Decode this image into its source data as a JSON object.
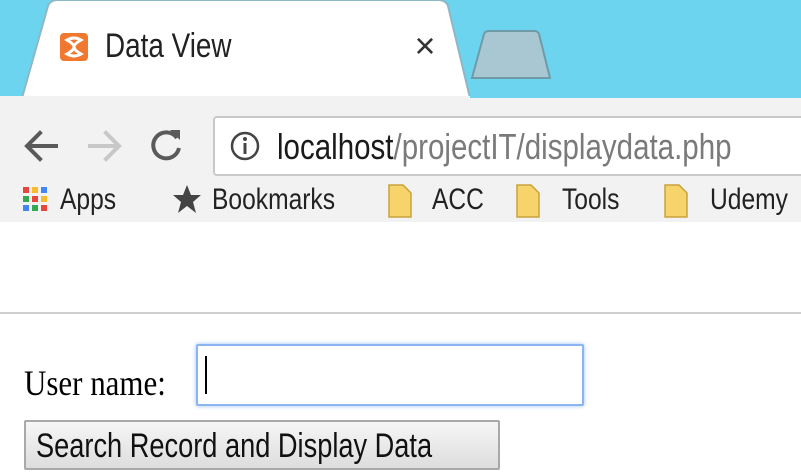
{
  "tab": {
    "title": "Data View",
    "close_glyph": "×",
    "favicon": "xampp-icon"
  },
  "toolbar": {
    "back_icon": "back-arrow-icon",
    "forward_icon": "forward-arrow-icon",
    "reload_icon": "reload-icon",
    "url_host": "localhost",
    "url_path": "/projectIT/displaydata.php",
    "info_icon": "info-icon"
  },
  "bookmarks": [
    {
      "label": "Apps",
      "icon": "apps-grid-icon"
    },
    {
      "label": "Bookmarks",
      "icon": "star-icon"
    },
    {
      "label": "ACC",
      "icon": "folder-icon"
    },
    {
      "label": "Tools",
      "icon": "folder-icon"
    },
    {
      "label": "Udemy",
      "icon": "folder-icon"
    }
  ],
  "form": {
    "username_label": "User name:",
    "username_value": "",
    "search_button_label": "Search Record and Display Data"
  },
  "colors": {
    "tab_strip": "#6cd4ef",
    "toolbar": "#f2f2f2",
    "favicon": "#f0782f",
    "folder": "#f7d36b"
  }
}
